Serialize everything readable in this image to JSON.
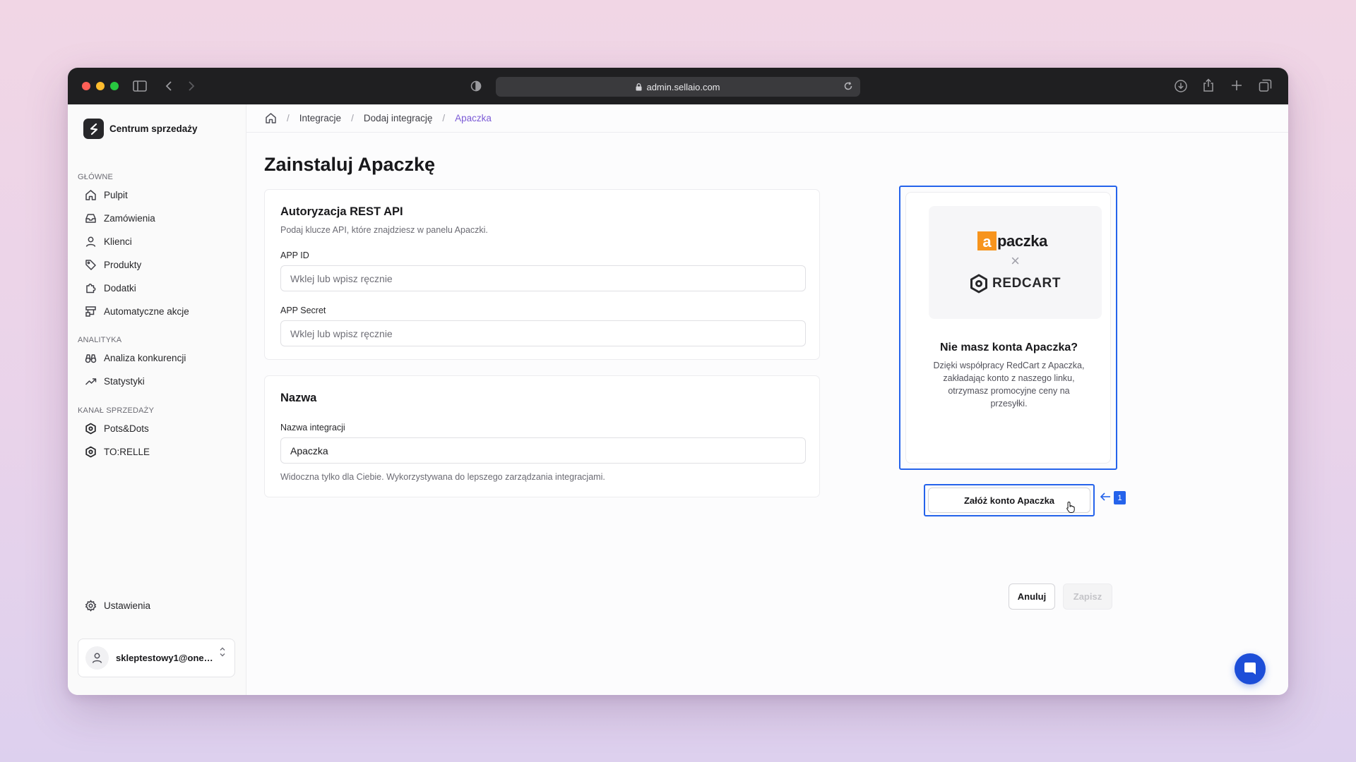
{
  "browser": {
    "url": "admin.sellaio.com"
  },
  "sidebar": {
    "brand": "Centrum sprzedaży",
    "sections": [
      {
        "title": "GŁÓWNE",
        "items": [
          "Pulpit",
          "Zamówienia",
          "Klienci",
          "Produkty",
          "Dodatki",
          "Automatyczne akcje"
        ]
      },
      {
        "title": "ANALITYKA",
        "items": [
          "Analiza konkurencji",
          "Statystyki"
        ]
      },
      {
        "title": "KANAŁ SPRZEDAŻY",
        "items": [
          "Pots&Dots",
          "TO:RELLE"
        ]
      }
    ],
    "settings": "Ustawienia",
    "user_email": "skleptestowy1@onet.pl"
  },
  "breadcrumb": [
    "Integracje",
    "Dodaj integrację",
    "Apaczka"
  ],
  "page": {
    "title": "Zainstaluj Apaczkę"
  },
  "auth_card": {
    "title": "Autoryzacja REST API",
    "subtitle": "Podaj klucze API, które znajdziesz w panelu Apaczki.",
    "app_id_label": "APP ID",
    "app_id_placeholder": "Wklej lub wpisz ręcznie",
    "app_id_value": "",
    "app_secret_label": "APP Secret",
    "app_secret_placeholder": "Wklej lub wpisz ręcznie",
    "app_secret_value": ""
  },
  "name_card": {
    "title": "Nazwa",
    "label": "Nazwa integracji",
    "value": "Apaczka",
    "hint": "Widoczna tylko dla Ciebie. Wykorzystywana do lepszego zarządzania integracjami."
  },
  "promo": {
    "logo_apaczka": "paczka",
    "logo_apaczka_letter": "a",
    "logo_cross": "×",
    "logo_redcart": "REDCART",
    "title": "Nie masz konta Apaczka?",
    "description": "Dzięki współpracy RedCart z Apaczka, zakładając konto z naszego linku, otrzymasz promocyjne ceny na przesyłki.",
    "button": "Załóż konto Apaczka",
    "annotation_number": "1"
  },
  "actions": {
    "cancel": "Anuluj",
    "save": "Zapisz"
  },
  "colors": {
    "accent": "#2563eb",
    "breadcrumb_active": "#7c5cd6",
    "apaczka_orange": "#f7941d"
  }
}
